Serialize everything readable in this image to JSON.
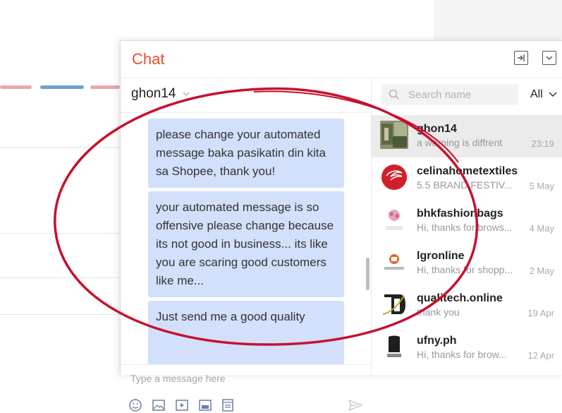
{
  "chat": {
    "title": "Chat",
    "accent_color": "#ee4d2d",
    "header_icons": [
      "expand-window-icon",
      "collapse-chevron-icon"
    ]
  },
  "conversation": {
    "contact_name": "ghon14",
    "messages": [
      {
        "text": "please change your automated message baka pasikatin din kita sa Shopee, thank you!"
      },
      {
        "text": "your automated message is so offensive please change because its not good in business... its like you are scaring good customers like me..."
      },
      {
        "text": "Just send me a good quality"
      }
    ],
    "input_placeholder": "Type a message here",
    "toolbar_icons": [
      "emoji-icon",
      "image-icon",
      "video-icon",
      "product-icon",
      "order-icon",
      "send-icon"
    ]
  },
  "sidebar": {
    "search_placeholder": "Search name",
    "filter_label": "All",
    "conversations": [
      {
        "name": "ghon14",
        "preview": "a warning is diffrent",
        "time": "23:19",
        "active": true
      },
      {
        "name": "celinahometextiles",
        "preview": "5.5 BRAND FESTIV...",
        "time": "5 May"
      },
      {
        "name": "bhkfashionbags",
        "preview": "Hi, thanks for brows...",
        "time": "4 May"
      },
      {
        "name": "lgronline",
        "preview": "Hi, thanks for shopp...",
        "time": "2 May"
      },
      {
        "name": "qualitech.online",
        "preview": "thank you",
        "time": "19 Apr"
      },
      {
        "name": "ufny.ph",
        "preview": "Hi, thanks for brow...",
        "time": "12 Apr"
      }
    ]
  },
  "annotation": {
    "color": "#c8102e"
  }
}
